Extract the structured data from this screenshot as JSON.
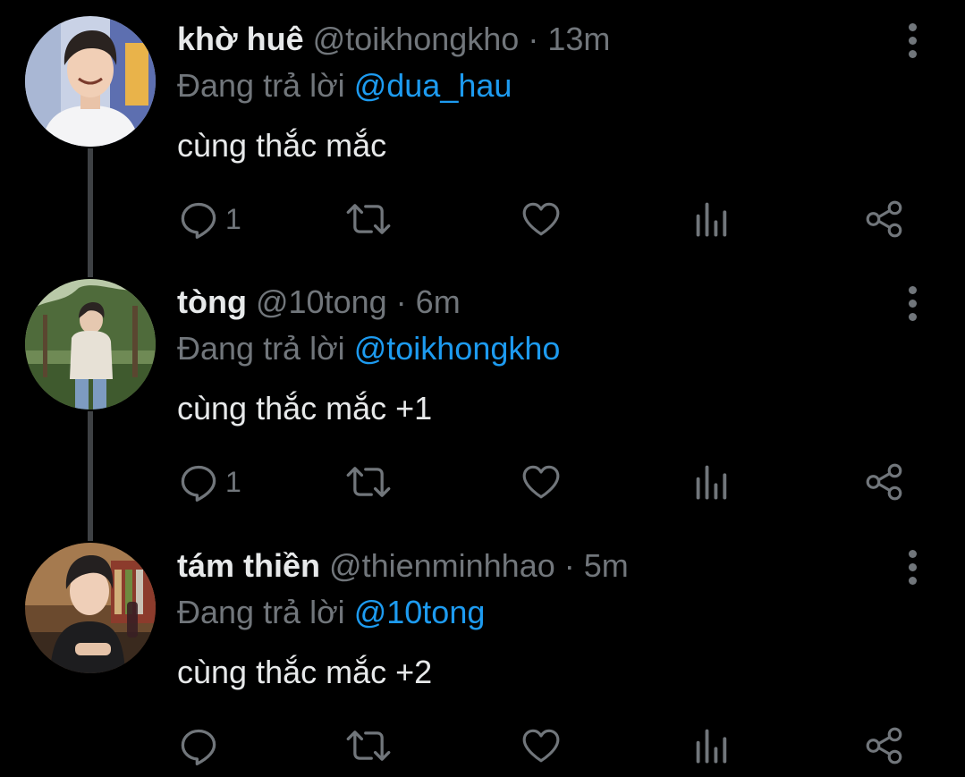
{
  "tweets": [
    {
      "display_name": "khờ huê",
      "handle": "@toikhongkho",
      "separator": "·",
      "time": "13m",
      "reply_prefix": "Đang trả lời",
      "reply_to": "@dua_hau",
      "text": "cùng thắc mắc",
      "reply_count": "1"
    },
    {
      "display_name": "tòng",
      "handle": "@10tong",
      "separator": "·",
      "time": "6m",
      "reply_prefix": "Đang trả lời",
      "reply_to": "@toikhongkho",
      "text": "cùng thắc mắc +1",
      "reply_count": "1"
    },
    {
      "display_name": "tám thiền",
      "handle": "@thienminhhao",
      "separator": "·",
      "time": "5m",
      "reply_prefix": "Đang trả lời",
      "reply_to": "@10tong",
      "text": "cùng thắc mắc +2",
      "reply_count": ""
    }
  ],
  "icons": {
    "reply": "reply-icon",
    "retweet": "retweet-icon",
    "like": "heart-icon",
    "views": "views-icon",
    "share": "share-icon",
    "more": "more-vertical-icon"
  },
  "colors": {
    "background": "#000000",
    "primary_text": "#e7e9ea",
    "secondary_text": "#71767b",
    "mention": "#1d9bf0",
    "thread_line": "#3e4144"
  }
}
